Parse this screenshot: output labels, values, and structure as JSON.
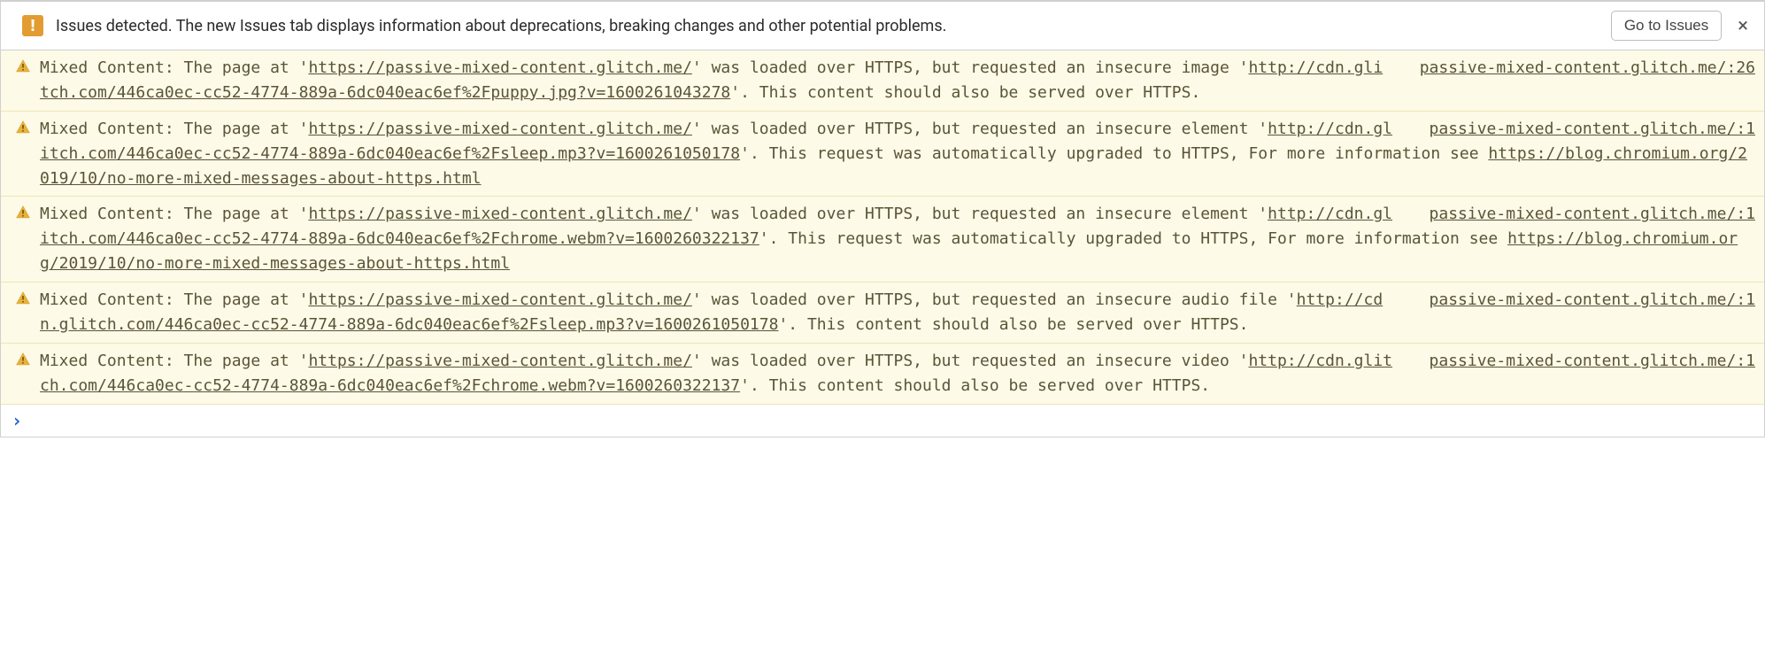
{
  "banner": {
    "icon_char": "!",
    "text": "Issues detected. The new Issues tab displays information about deprecations, breaking changes and other potential problems.",
    "button_label": "Go to Issues",
    "close_label": "×"
  },
  "messages": [
    {
      "source": "passive-mixed-content.glitch.me/:26",
      "parts": [
        {
          "t": "Mixed Content: The page at '"
        },
        {
          "t": "https://passive-mixed-content.glitch.me/",
          "link": true
        },
        {
          "t": "' was loaded over HTTPS, but requested an insecure image '"
        },
        {
          "t": "http://cdn.glitch.com/446ca0ec-cc52-4774-889a-6dc040eac6ef%2Fpuppy.jpg?v=1600261043278",
          "link": true
        },
        {
          "t": "'. This content should also be served over HTTPS."
        }
      ]
    },
    {
      "source": "passive-mixed-content.glitch.me/:1",
      "parts": [
        {
          "t": "Mixed Content: The page at '"
        },
        {
          "t": "https://passive-mixed-content.glitch.me/",
          "link": true
        },
        {
          "t": "' was loaded over HTTPS, but requested an insecure element '"
        },
        {
          "t": "http://cdn.glitch.com/446ca0ec-cc52-4774-889a-6dc040eac6ef%2Fsleep.mp3?v=1600261050178",
          "link": true
        },
        {
          "t": "'. This request was automatically upgraded to HTTPS, For more information see "
        },
        {
          "t": "https://blog.chromium.org/2019/10/no-more-mixed-messages-about-https.html",
          "link": true
        }
      ]
    },
    {
      "source": "passive-mixed-content.glitch.me/:1",
      "parts": [
        {
          "t": "Mixed Content: The page at '"
        },
        {
          "t": "https://passive-mixed-content.glitch.me/",
          "link": true
        },
        {
          "t": "' was loaded over HTTPS, but requested an insecure element '"
        },
        {
          "t": "http://cdn.glitch.com/446ca0ec-cc52-4774-889a-6dc040eac6ef%2Fchrome.webm?v=1600260322137",
          "link": true
        },
        {
          "t": "'. This request was automatically upgraded to HTTPS, For more information see "
        },
        {
          "t": "https://blog.chromium.org/2019/10/no-more-mixed-messages-about-https.html",
          "link": true
        }
      ]
    },
    {
      "source": "passive-mixed-content.glitch.me/:1",
      "parts": [
        {
          "t": "Mixed Content: The page at '"
        },
        {
          "t": "https://passive-mixed-content.glitch.me/",
          "link": true
        },
        {
          "t": "' was loaded over HTTPS, but requested an insecure audio file '"
        },
        {
          "t": "http://cdn.glitch.com/446ca0ec-cc52-4774-889a-6dc040eac6ef%2Fsleep.mp3?v=1600261050178",
          "link": true
        },
        {
          "t": "'. This content should also be served over HTTPS."
        }
      ]
    },
    {
      "source": "passive-mixed-content.glitch.me/:1",
      "parts": [
        {
          "t": "Mixed Content: The page at '"
        },
        {
          "t": "https://passive-mixed-content.glitch.me/",
          "link": true
        },
        {
          "t": "' was loaded over HTTPS, but requested an insecure video '"
        },
        {
          "t": "http://cdn.glitch.com/446ca0ec-cc52-4774-889a-6dc040eac6ef%2Fchrome.webm?v=1600260322137",
          "link": true
        },
        {
          "t": "'. This content should also be served over HTTPS."
        }
      ]
    }
  ],
  "prompt": {
    "chevron": "›"
  }
}
